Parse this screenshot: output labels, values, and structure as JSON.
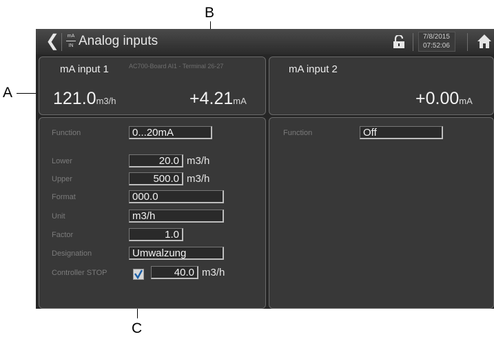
{
  "callouts": {
    "a": "A",
    "b": "B",
    "c": "C"
  },
  "header": {
    "title": "Analog inputs",
    "back_icon": "chevron-left-icon",
    "module_icon": "mA-IN-icon",
    "mA_icon_top": "mA",
    "mA_icon_bottom": "IN",
    "lock_icon": "unlock-icon",
    "date": "7/8/2015",
    "time": "07:52:06",
    "home_icon": "home-icon"
  },
  "input1": {
    "title": "mA input 1",
    "source": "AC700-Board  AI1 - Terminal 26-27",
    "value": "121.0",
    "value_unit": "m3/h",
    "current": "+4.21",
    "current_unit": "mA",
    "config": {
      "function_label": "Function",
      "function_value": "0...20mA",
      "lower_label": "Lower",
      "lower_value": "20.0",
      "lower_unit": "m3/h",
      "upper_label": "Upper",
      "upper_value": "500.0",
      "upper_unit": "m3/h",
      "format_label": "Format",
      "format_value": "000.0",
      "unit_label": "Unit",
      "unit_value": "m3/h",
      "factor_label": "Factor",
      "factor_value": "1.0",
      "designation_label": "Designation",
      "designation_value": "Umwalzung",
      "controller_stop_label": "Controller STOP",
      "controller_stop_checked": true,
      "controller_stop_value": "40.0",
      "controller_stop_unit": "m3/h"
    }
  },
  "input2": {
    "title": "mA input 2",
    "current": "+0.00",
    "current_unit": "mA",
    "config": {
      "function_label": "Function",
      "function_value": "Off"
    }
  },
  "colors": {
    "screen_bg": "#262626",
    "panel_bg": "#383838",
    "label_gray": "#7b7b7b"
  }
}
